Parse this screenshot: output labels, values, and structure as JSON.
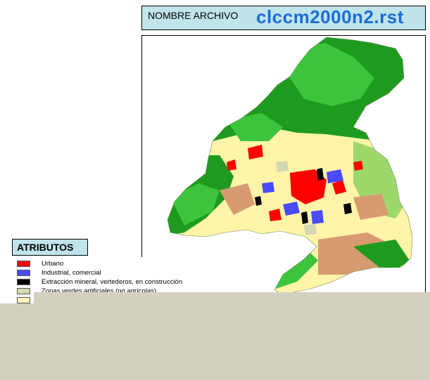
{
  "header": {
    "label": "NOMBRE ARCHIVO",
    "file_name": "clccm2000n2.rst"
  },
  "attributes": {
    "title": "ATRIBUTOS",
    "items": [
      {
        "label": "Urbano",
        "color": "#ff0000"
      },
      {
        "label": "Industrial, comercial",
        "color": "#4a4aff"
      },
      {
        "label": "Extracción mineral, vertederos, en construcción",
        "color": "#000000"
      },
      {
        "label": "Zonas verdes artificiales (no agrícolas)",
        "color": "#d4d8b0"
      },
      {
        "label": "",
        "color": "#fff8b8"
      }
    ]
  },
  "colors": {
    "header_bg": "#c0e4ec",
    "file_name": "#1c6cd8",
    "forest_dark": "#1e9b1e",
    "forest_light": "#3cc43c",
    "agri": "#fff4a8",
    "orchard": "#d89a70",
    "pasture": "#9ed86a",
    "panel": "#d4d0c0"
  }
}
